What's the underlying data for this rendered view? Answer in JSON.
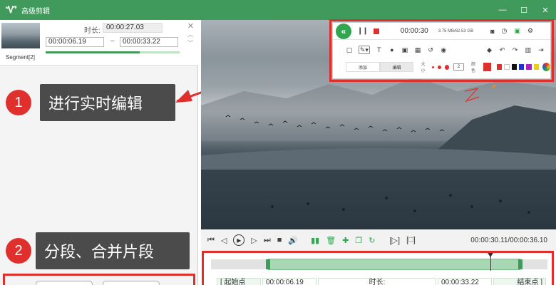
{
  "window": {
    "title": "高级剪辑",
    "logo_glyph": "Ꮙ",
    "buttons": {
      "minimize": "—",
      "maximize": "☐",
      "close": "✕"
    }
  },
  "segment": {
    "name": "Segment[2]",
    "duration_label": "时长:",
    "duration_value": "00:00:27.03",
    "start_time": "00:00:06.19",
    "end_time": "00:00:33.22",
    "separator": "–",
    "close_glyph": "✕",
    "up_glyph": "︿",
    "down_glyph": "﹀",
    "progress": 0.7
  },
  "callouts": [
    {
      "number": "1",
      "text": "进行实时编辑"
    },
    {
      "number": "2",
      "text": "分段、合并片段"
    }
  ],
  "recorder": {
    "collapse_glyph": "«",
    "pause_glyph": "❙❙",
    "time": "00:00:30",
    "size": "3.75 MB/62.53 GB",
    "icons": [
      "camera-icon",
      "timer-icon",
      "toolbox-icon",
      "settings-icon"
    ],
    "tool_icons": [
      "rectangle-icon",
      "pen-icon",
      "text-icon",
      "number-icon",
      "image-icon",
      "mosaic-icon",
      "undo-icon",
      "record-icon",
      "eraser-icon",
      "rotate-left-icon",
      "rotate-right-icon",
      "delete-icon",
      "exit-icon"
    ],
    "tab_add": "添加",
    "tab_edit": "编辑",
    "size_label": "大小",
    "size_value": "2",
    "color_label": "颜色",
    "colors": [
      "#e0302d",
      "#e0302d",
      "#ffffff",
      "#111111",
      "#2233cc",
      "#b020c0",
      "#f0d000"
    ]
  },
  "annotation_color": "#e0302d",
  "player": {
    "time": "00:00:30.11/00:00:36.10"
  },
  "timeline": {
    "start_label": "[ 起始点",
    "start_value": "00:00:06.19",
    "duration_label": "时长:",
    "end_value": "00:00:33.22",
    "end_label": "结束点 ]",
    "selection_start": 0.17,
    "selection_end": 0.92,
    "playhead": 0.83
  },
  "accent": "#3f9a5c",
  "highlight": "#e0302d"
}
